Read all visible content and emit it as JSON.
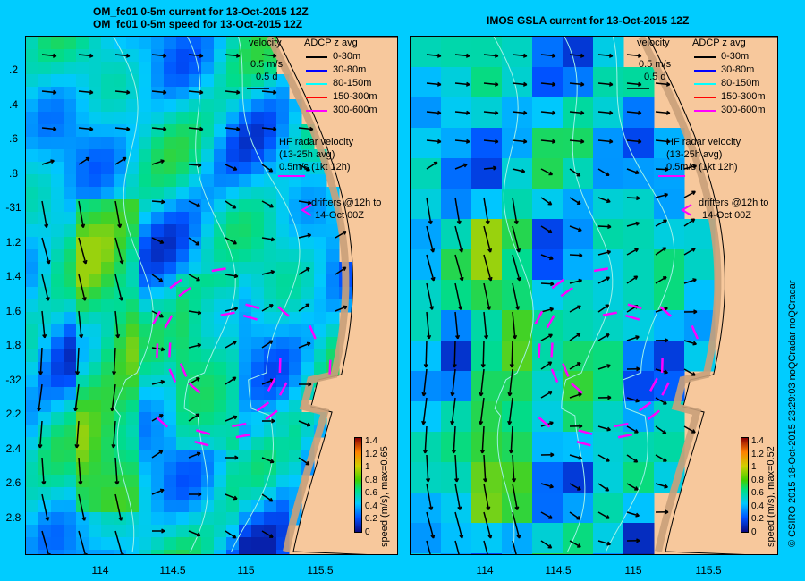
{
  "left_panel": {
    "title_line1": "OM_fc01 0-5m current for 13-Oct-2015 12Z",
    "title_line2": "OM_fc01 0-5m speed for 13-Oct-2015 12Z",
    "colorbar_label": "speed (m/s), max=0.65"
  },
  "right_panel": {
    "title": "IMOS GSLA current for 13-Oct-2015 12Z",
    "colorbar_label": "speed (m/s), max=0.52"
  },
  "legend": {
    "velocity": "velocity",
    "scale1": "0.5 m/s",
    "scale2": "0.5 d",
    "adcp_title": "ADCP z avg",
    "adcp_items": [
      {
        "label": "0-30m",
        "color": "#000000"
      },
      {
        "label": "30-80m",
        "color": "#0000ff"
      },
      {
        "label": "80-150m",
        "color": "#00ffff"
      },
      {
        "label": "150-300m",
        "color": "#ff0000"
      },
      {
        "label": "300-600m",
        "color": "#ff00ff"
      }
    ],
    "hf_line1": "HF radar velocity",
    "hf_line2": "(13-25h avg)",
    "hf_line3": "0.5m/s (1kt 12h)",
    "drifters_line1": "drifters @12h to",
    "drifters_line2": "14-Oct 00Z"
  },
  "y_ticks": [
    ".2",
    ".4",
    ".6",
    ".8",
    "-31",
    "1.2",
    "1.4",
    "1.6",
    "1.8",
    "-32",
    "2.2",
    "2.4",
    "2.6",
    "2.8"
  ],
  "x_ticks": [
    "114",
    "114.5",
    "115",
    "115.5"
  ],
  "colorbar_ticks": [
    "1.4",
    "1.2",
    "1",
    "0.8",
    "0.6",
    "0.4",
    "0.2",
    "0"
  ],
  "credit": "© CSIRO 2015   18-Oct-2015 23:29:03 noQCradar noQCradar"
}
